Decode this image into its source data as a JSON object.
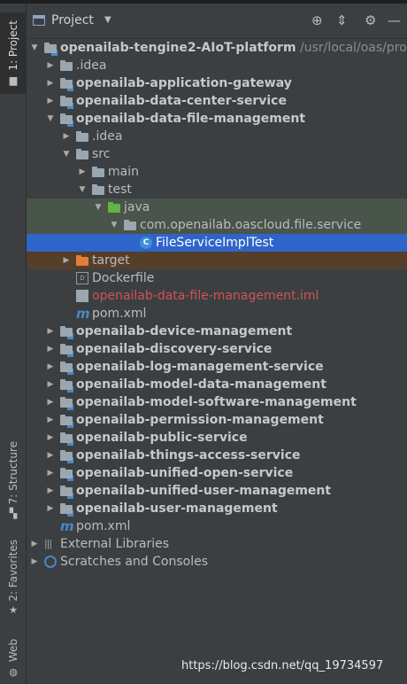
{
  "toolstrip": {
    "project_tab": "1: Project",
    "structure_tab": "7: Structure",
    "favorites_tab": "2: Favorites",
    "web_tab": "Web"
  },
  "header": {
    "title": "Project",
    "caret": "▼",
    "locate_icon": "⊕",
    "collapse_icon": "⇕",
    "settings_icon": "⚙",
    "hide_icon": "—"
  },
  "tree": [
    {
      "label": "openailab-tengine2-AIoT-platform",
      "suffix": " /usr/local/oas/pro",
      "depth": 0,
      "arrow": "▼",
      "icon": "module-folder",
      "style": "bold"
    },
    {
      "label": ".idea",
      "depth": 1,
      "arrow": "▶",
      "icon": "folder",
      "style": "plain"
    },
    {
      "label": "openailab-application-gateway",
      "depth": 1,
      "arrow": "▶",
      "icon": "module-folder",
      "style": "bold"
    },
    {
      "label": "openailab-data-center-service",
      "depth": 1,
      "arrow": "▶",
      "icon": "module-folder",
      "style": "bold"
    },
    {
      "label": "openailab-data-file-management",
      "depth": 1,
      "arrow": "▼",
      "icon": "module-folder",
      "style": "bold"
    },
    {
      "label": ".idea",
      "depth": 2,
      "arrow": "▶",
      "icon": "folder",
      "style": "plain"
    },
    {
      "label": "src",
      "depth": 2,
      "arrow": "▼",
      "icon": "folder",
      "style": "plain"
    },
    {
      "label": "main",
      "depth": 3,
      "arrow": "▶",
      "icon": "folder",
      "style": "plain"
    },
    {
      "label": "test",
      "depth": 3,
      "arrow": "▼",
      "icon": "folder",
      "style": "plain"
    },
    {
      "label": "java",
      "depth": 4,
      "arrow": "▼",
      "icon": "test-folder",
      "style": "plain",
      "bg": "testsrc"
    },
    {
      "label": "com.openailab.oascloud.file.service",
      "depth": 5,
      "arrow": "▼",
      "icon": "package",
      "style": "plain",
      "bg": "testsrc"
    },
    {
      "label": "FileServiceImplTest",
      "depth": 6,
      "arrow": "",
      "icon": "class",
      "style": "plain",
      "bg": "selected"
    },
    {
      "label": "target",
      "depth": 2,
      "arrow": "▶",
      "icon": "excluded-folder",
      "style": "plain",
      "bg": "excluded"
    },
    {
      "label": "Dockerfile",
      "depth": 2,
      "arrow": "",
      "icon": "docker",
      "style": "plain"
    },
    {
      "label": "openailab-data-file-management.iml",
      "depth": 2,
      "arrow": "",
      "icon": "iml",
      "style": "red"
    },
    {
      "label": "pom.xml",
      "depth": 2,
      "arrow": "",
      "icon": "maven",
      "style": "plain"
    },
    {
      "label": "openailab-device-management",
      "depth": 1,
      "arrow": "▶",
      "icon": "module-folder",
      "style": "bold"
    },
    {
      "label": "openailab-discovery-service",
      "depth": 1,
      "arrow": "▶",
      "icon": "module-folder",
      "style": "bold"
    },
    {
      "label": "openailab-log-management-service",
      "depth": 1,
      "arrow": "▶",
      "icon": "module-folder",
      "style": "bold"
    },
    {
      "label": "openailab-model-data-management",
      "depth": 1,
      "arrow": "▶",
      "icon": "module-folder",
      "style": "bold"
    },
    {
      "label": "openailab-model-software-management",
      "depth": 1,
      "arrow": "▶",
      "icon": "module-folder",
      "style": "bold"
    },
    {
      "label": "openailab-permission-management",
      "depth": 1,
      "arrow": "▶",
      "icon": "module-folder",
      "style": "bold"
    },
    {
      "label": "openailab-public-service",
      "depth": 1,
      "arrow": "▶",
      "icon": "module-folder",
      "style": "bold"
    },
    {
      "label": "openailab-things-access-service",
      "depth": 1,
      "arrow": "▶",
      "icon": "module-folder",
      "style": "bold"
    },
    {
      "label": "openailab-unified-open-service",
      "depth": 1,
      "arrow": "▶",
      "icon": "module-folder",
      "style": "bold"
    },
    {
      "label": "openailab-unified-user-management",
      "depth": 1,
      "arrow": "▶",
      "icon": "module-folder",
      "style": "bold"
    },
    {
      "label": "openailab-user-management",
      "depth": 1,
      "arrow": "▶",
      "icon": "module-folder",
      "style": "bold"
    },
    {
      "label": "pom.xml",
      "depth": 1,
      "arrow": "",
      "icon": "maven",
      "style": "plain"
    },
    {
      "label": "External Libraries",
      "depth": 0,
      "arrow": "▶",
      "icon": "library",
      "style": "plain"
    },
    {
      "label": "Scratches and Consoles",
      "depth": 0,
      "arrow": "▶",
      "icon": "scratch",
      "style": "plain"
    }
  ],
  "icons": {
    "maven_glyph": "m",
    "docker_glyph": "D",
    "class_glyph": "C",
    "library_glyph": "|||"
  },
  "colors": {
    "selection": "#2f65ca",
    "test_source_bg": "#49544a",
    "excluded_bg": "#553e2a",
    "module_badge": "#4a88c7",
    "unversioned_text": "#d25252"
  },
  "watermark": "https://blog.csdn.net/qq_19734597"
}
